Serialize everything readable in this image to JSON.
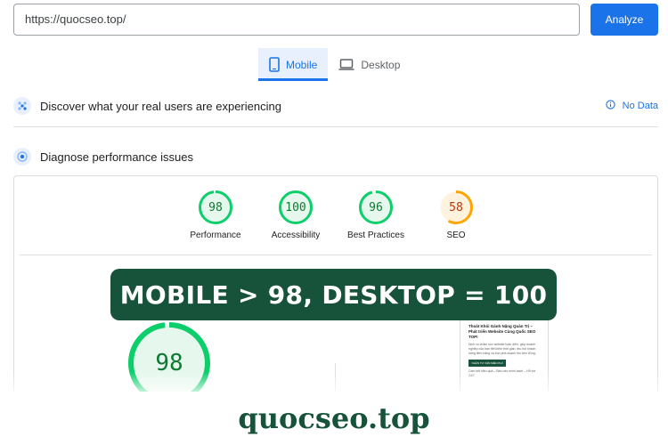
{
  "search": {
    "url_value": "https://quocseo.top/",
    "analyze_label": "Analyze"
  },
  "tabs": [
    {
      "label": "Mobile",
      "icon": "smartphone-icon",
      "active": true
    },
    {
      "label": "Desktop",
      "icon": "laptop-icon",
      "active": false
    }
  ],
  "field_data": {
    "title": "Discover what your real users are experiencing",
    "no_data_label": "No Data",
    "icon": "users-icon"
  },
  "lab_data": {
    "title": "Diagnose performance issues",
    "icon": "pulse-icon"
  },
  "scores": [
    {
      "value": "98",
      "label": "Performance",
      "fraction": 0.98,
      "color": "#0cce6b",
      "text_color": "#0c7a2f",
      "bg": "#e6f8ee"
    },
    {
      "value": "100",
      "label": "Accessibility",
      "fraction": 1.0,
      "color": "#0cce6b",
      "text_color": "#0c7a2f",
      "bg": "#e6f8ee"
    },
    {
      "value": "96",
      "label": "Best Practices",
      "fraction": 0.96,
      "color": "#0cce6b",
      "text_color": "#0c7a2f",
      "bg": "#e6f8ee"
    },
    {
      "value": "58",
      "label": "SEO",
      "fraction": 0.58,
      "color": "#ffa400",
      "text_color": "#c33300",
      "bg": "#fff3e0"
    }
  ],
  "big_score": {
    "value": "98",
    "fraction": 0.98,
    "color": "#0cce6b"
  },
  "preview": {
    "title": "Thoát Khỏi Gánh Nặng Quản Trị – Phát triển Website Cùng Quốc SEO TOP!",
    "text": "Dịch vụ chăm sóc website toàn diện, giúp doanh nghiệp của bạn tiết kiệm thời gian, thu hút khách hàng tiềm năng và bùn phá doanh thu bền vững.",
    "button": "NHẬN TƯ VẤN MIỄN PHÍ",
    "footer": "Cam kết hiệu quả – Báo cáo minh bạch – Hỗ trợ 24/7"
  },
  "banner": {
    "text": "MOBILE > 98, DESKTOP = 100"
  },
  "brand": {
    "text": "quocseo.top"
  },
  "colors": {
    "accent": "#1a73e8",
    "brand_green": "#17523a",
    "pass": "#0cce6b",
    "average": "#ffa400"
  }
}
